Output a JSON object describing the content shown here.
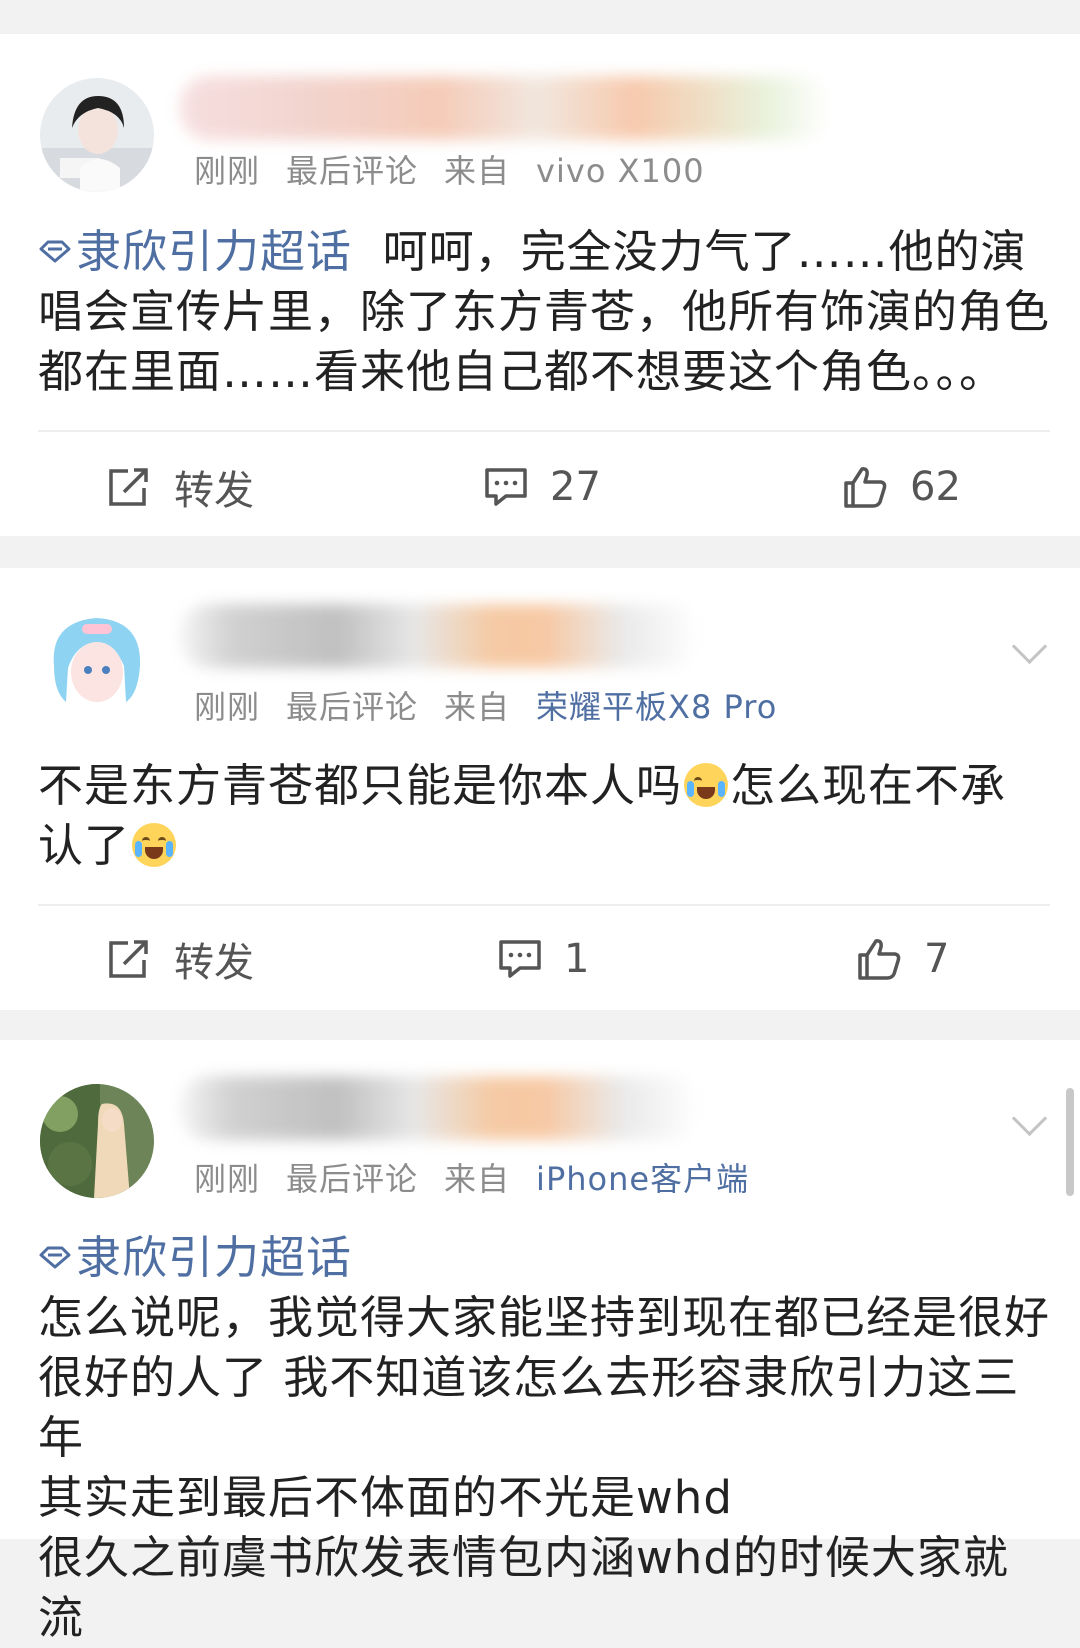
{
  "posts": [
    {
      "meta": {
        "time": "刚刚",
        "last_comment": "最后评论",
        "source_prefix": "来自",
        "source_name": "vivo X100"
      },
      "topic": "隶欣引力超话",
      "text": "呵呵，完全没力气了……他的演唱会宣传片里，除了东方青苍，他所有饰演的角色都在里面……看来他自己都不想要这个角色。。。",
      "repost_label": "转发",
      "comments": "27",
      "likes": "62"
    },
    {
      "meta": {
        "time": "刚刚",
        "last_comment": "最后评论",
        "source_prefix": "来自",
        "source_name": "荣耀平板X8 Pro"
      },
      "text_part1": "不是东方青苍都只能是你本人吗",
      "text_part2": "怎么现在不承认了",
      "repost_label": "转发",
      "comments": "1",
      "likes": "7"
    },
    {
      "meta": {
        "time": "刚刚",
        "last_comment": "最后评论",
        "source_prefix": "来自",
        "source_name": "iPhone客户端"
      },
      "topic": "隶欣引力超话",
      "lines": [
        "怎么说呢，我觉得大家能坚持到现在都已经是很好",
        "很好的人了 我不知道该怎么去形容隶欣引力这三年",
        "其实走到最后不体面的不光是whd",
        "很久之前虞书欣发表情包内涵whd的时候大家就流"
      ]
    }
  ],
  "icons": {
    "repost": "repost-icon",
    "comment": "comment-icon",
    "like": "thumbs-up-icon",
    "topic": "supertopic-diamond-icon",
    "emoji_cry": "crying-emoji-icon",
    "emoji_laugh": "laughing-tears-emoji-icon",
    "more": "chevron-down-icon"
  },
  "colors": {
    "link": "#4f6fa3",
    "meta": "#8c8c8c",
    "background": "#f2f2f2"
  }
}
